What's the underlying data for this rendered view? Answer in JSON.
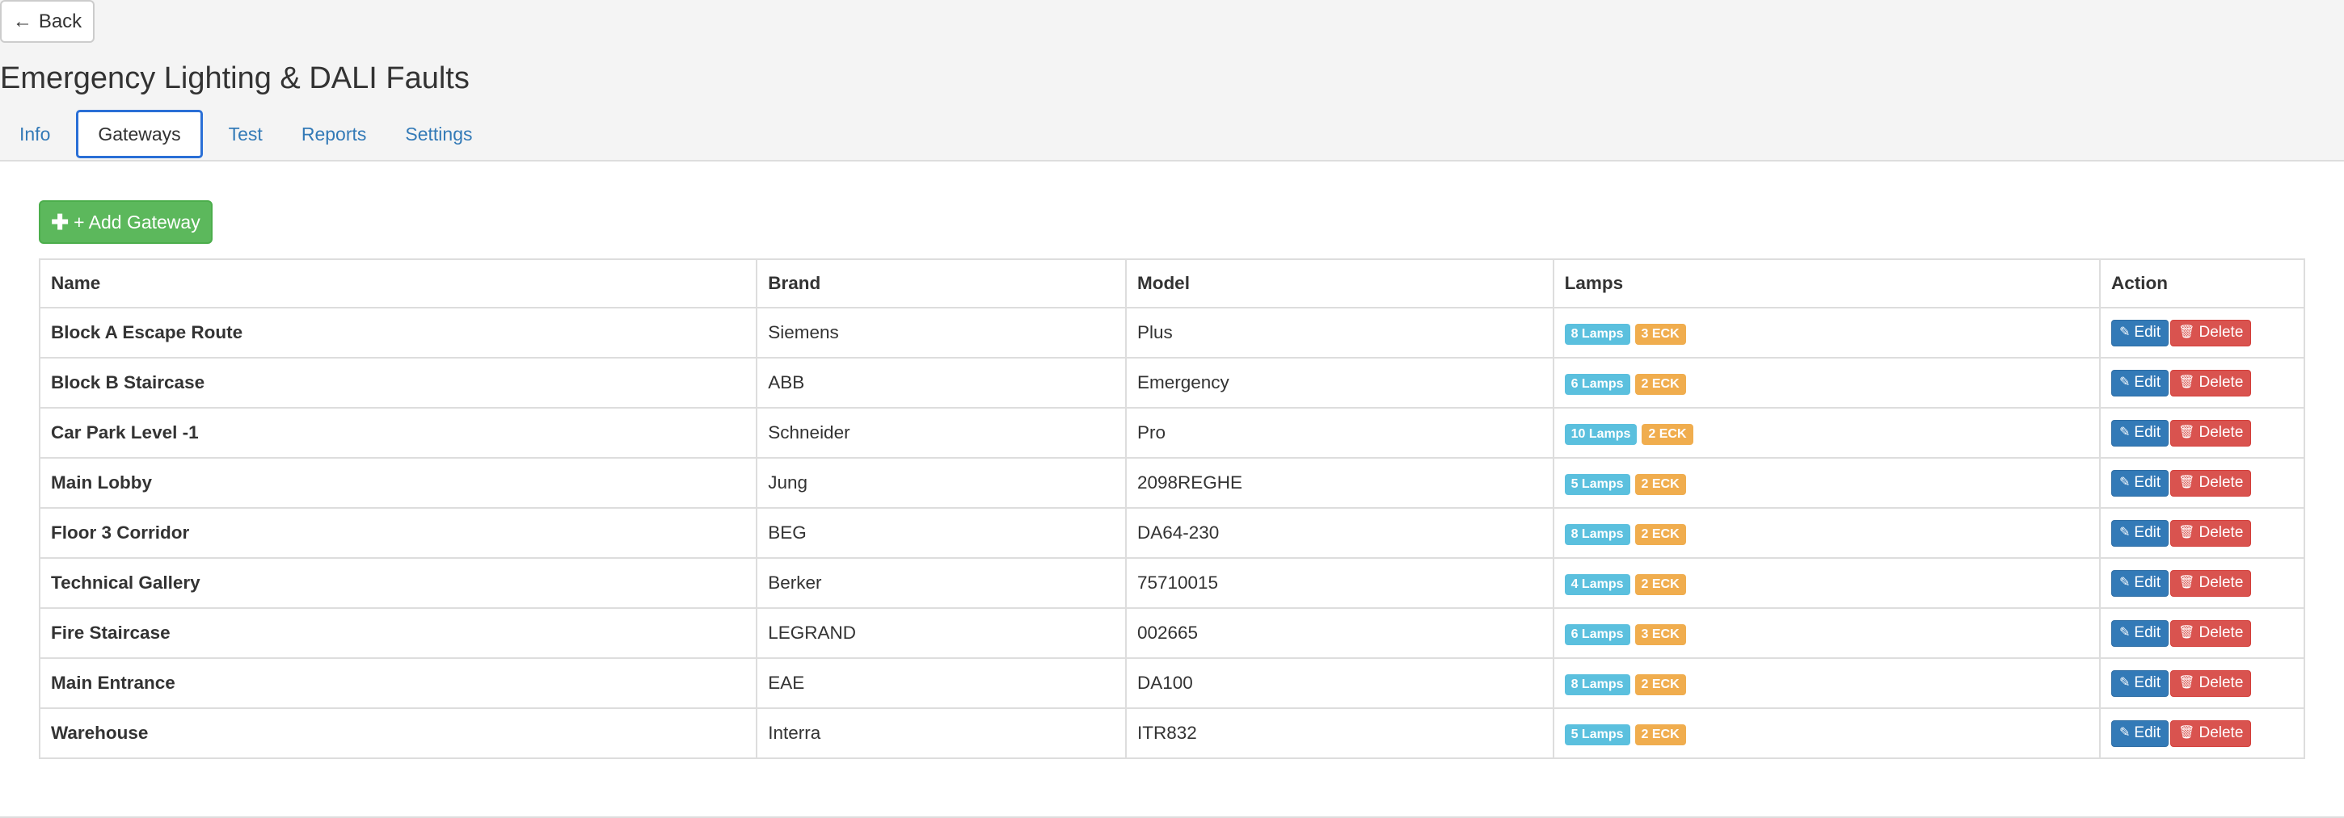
{
  "back": {
    "label": "Back",
    "icon": "arrow-left-icon"
  },
  "page_title": "Emergency Lighting & DALI Faults",
  "tabs": [
    {
      "label": "Info",
      "active": false
    },
    {
      "label": "Gateways",
      "active": true
    },
    {
      "label": "Test",
      "active": false
    },
    {
      "label": "Reports",
      "active": false
    },
    {
      "label": "Settings",
      "active": false
    }
  ],
  "add_button": {
    "label": "+ Add Gateway",
    "icon": "plus-icon"
  },
  "table": {
    "headers": {
      "name": "Name",
      "brand": "Brand",
      "model": "Model",
      "lamps": "Lamps",
      "action": "Action"
    },
    "rows": [
      {
        "name": "Block A Escape Route",
        "brand": "Siemens",
        "model": "Plus",
        "lamps": "8 Lamps",
        "eck": "3 ECK"
      },
      {
        "name": "Block B Staircase",
        "brand": "ABB",
        "model": "Emergency",
        "lamps": "6 Lamps",
        "eck": "2 ECK"
      },
      {
        "name": "Car Park Level -1",
        "brand": "Schneider",
        "model": "Pro",
        "lamps": "10 Lamps",
        "eck": "2 ECK"
      },
      {
        "name": "Main Lobby",
        "brand": "Jung",
        "model": "2098REGHE",
        "lamps": "5 Lamps",
        "eck": "2 ECK"
      },
      {
        "name": "Floor 3 Corridor",
        "brand": "BEG",
        "model": "DA64-230",
        "lamps": "8 Lamps",
        "eck": "2 ECK"
      },
      {
        "name": "Technical Gallery",
        "brand": "Berker",
        "model": "75710015",
        "lamps": "4 Lamps",
        "eck": "2 ECK"
      },
      {
        "name": "Fire Staircase",
        "brand": "LEGRAND",
        "model": "002665",
        "lamps": "6 Lamps",
        "eck": "3 ECK"
      },
      {
        "name": "Main Entrance",
        "brand": "EAE",
        "model": "DA100",
        "lamps": "8 Lamps",
        "eck": "2 ECK"
      },
      {
        "name": "Warehouse",
        "brand": "Interra",
        "model": "ITR832",
        "lamps": "5 Lamps",
        "eck": "2 ECK"
      }
    ],
    "edit_label": "Edit",
    "delete_label": "Delete",
    "edit_icon": "pencil-icon",
    "delete_icon": "trash-icon"
  },
  "colors": {
    "link": "#337ab7",
    "success": "#5cb85c",
    "info": "#5bc0de",
    "warning": "#f0ad4e",
    "danger": "#d9534f",
    "primary": "#337ab7",
    "active_tab_border": "#2a6fd6"
  }
}
